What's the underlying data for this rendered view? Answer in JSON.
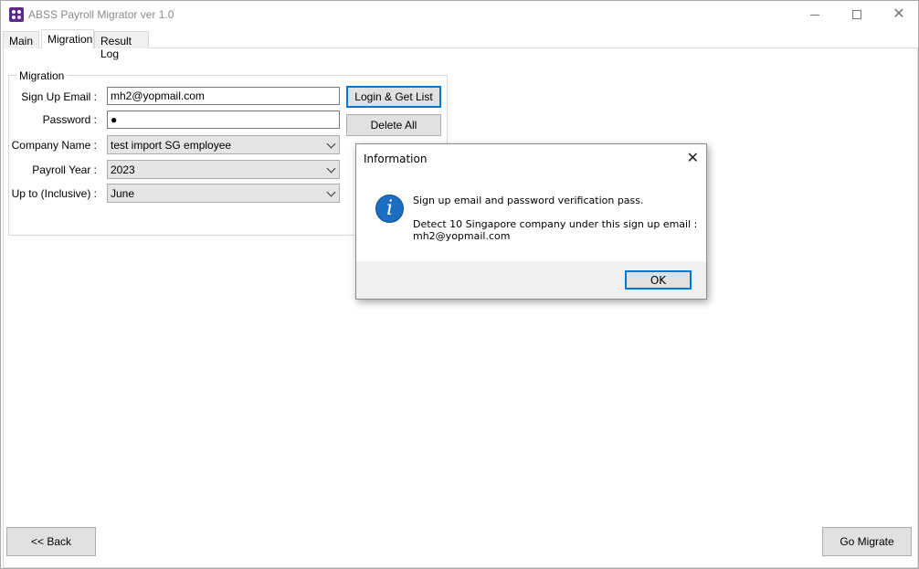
{
  "window": {
    "title": "ABSS Payroll Migrator ver 1.0"
  },
  "tabs": [
    {
      "label": "Main"
    },
    {
      "label": "Migration"
    },
    {
      "label": "Result Log"
    }
  ],
  "migration": {
    "group_label": "Migration",
    "email_label": "Sign Up Email :",
    "email_value": "mh2@yopmail.com",
    "password_label": "Password :",
    "password_value": "●",
    "company_label": "Company Name :",
    "company_value": "test import SG employee",
    "year_label": "Payroll Year :",
    "year_value": "2023",
    "upto_label": "Up to (Inclusive) :",
    "upto_value": "June",
    "login_button": "Login & Get List",
    "delete_button": "Delete All"
  },
  "footer": {
    "back_button": "<< Back",
    "go_button": "Go Migrate"
  },
  "dialog": {
    "title": "Information",
    "icon_glyph": "i",
    "line1": "Sign up email and password verification pass.",
    "line2": "Detect 10 Singapore company under this sign up email :",
    "line3": "mh2@yopmail.com",
    "ok_button": "OK"
  },
  "colors": {
    "accent": "#0078d7",
    "info_icon": "#1b6ec2"
  }
}
